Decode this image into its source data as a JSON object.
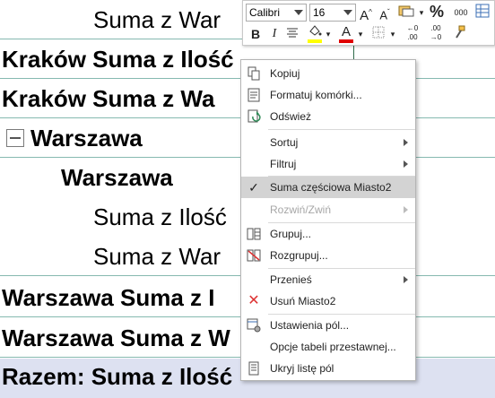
{
  "sheet": {
    "rows": [
      {
        "text": "Suma z War",
        "bold": false
      },
      {
        "text": "Kraków Suma z Ilość",
        "bold": true
      },
      {
        "text": "Kraków Suma z Wa",
        "bold": true
      },
      {
        "text": "Warszawa",
        "bold": true
      },
      {
        "text": "Warszawa",
        "bold": true
      },
      {
        "text": "Suma z Ilość",
        "bold": false
      },
      {
        "text": "Suma z War",
        "bold": false
      },
      {
        "text": "Warszawa Suma z I",
        "bold": true
      },
      {
        "text": "Warszawa Suma z W",
        "bold": true
      },
      {
        "text": "Razem: Suma z Ilość",
        "bold": true
      }
    ]
  },
  "mini_toolbar": {
    "font_name": "Calibri",
    "font_size": "16",
    "bold": "B",
    "italic": "I",
    "fill_color": "#ffff00",
    "font_color": "#e00000",
    "percent": "%",
    "thousands": "000"
  },
  "context_menu": {
    "items": [
      {
        "label": "Kopiuj",
        "icon": "copy-icon"
      },
      {
        "label": "Formatuj komórki...",
        "icon": "format-cells-icon"
      },
      {
        "label": "Odśwież",
        "icon": "refresh-icon"
      },
      {
        "label": "Sortuj",
        "icon": ""
      },
      {
        "label": "Filtruj",
        "icon": ""
      },
      {
        "label": "Suma częściowa Miasto2",
        "icon": "checkmark-icon"
      },
      {
        "label": "Rozwiń/Zwiń",
        "icon": ""
      },
      {
        "label": "Grupuj...",
        "icon": "group-icon"
      },
      {
        "label": "Rozgrupuj...",
        "icon": "ungroup-icon"
      },
      {
        "label": "Przenieś",
        "icon": ""
      },
      {
        "label": "Usuń Miasto2",
        "icon": "remove-icon"
      },
      {
        "label": "Ustawienia pól...",
        "icon": "field-settings-icon"
      },
      {
        "label": "Opcje tabeli przestawnej...",
        "icon": ""
      },
      {
        "label": "Ukryj listę pól",
        "icon": "field-list-icon"
      }
    ]
  },
  "colors": {
    "row_border": "#86b9b0",
    "total_row_bg": "#dde1f1",
    "menu_highlight": "#d3d3d3"
  }
}
